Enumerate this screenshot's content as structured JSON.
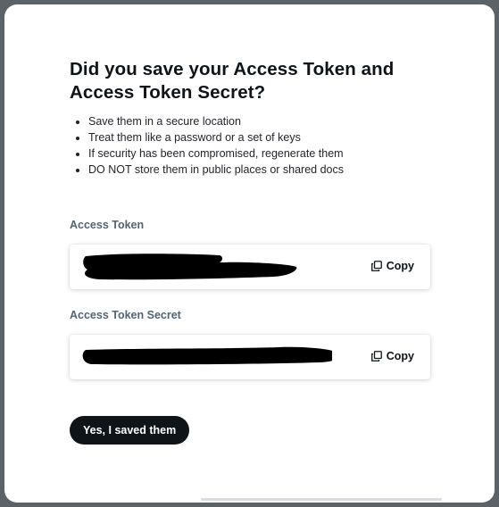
{
  "dialog": {
    "title": "Did you save your Access Token and Access Token Secret?",
    "bullets": [
      "Save them in a secure location",
      "Treat them like a password or a set of keys",
      "If security has been compromised, regenerate them",
      "DO NOT store them in public places or shared docs"
    ],
    "access_token": {
      "label": "Access Token",
      "value_state": "redacted",
      "copy_label": "Copy"
    },
    "access_token_secret": {
      "label": "Access Token Secret",
      "value_state": "redacted",
      "copy_label": "Copy"
    },
    "confirm_label": "Yes, I saved them"
  },
  "colors": {
    "backdrop": "#5b6268",
    "surface": "#ffffff",
    "text_primary": "#0f1419",
    "text_secondary": "#536471",
    "button_bg": "#0f1419",
    "button_text": "#ffffff",
    "redaction": "#000000"
  },
  "icons": {
    "copy": "copy-icon"
  }
}
